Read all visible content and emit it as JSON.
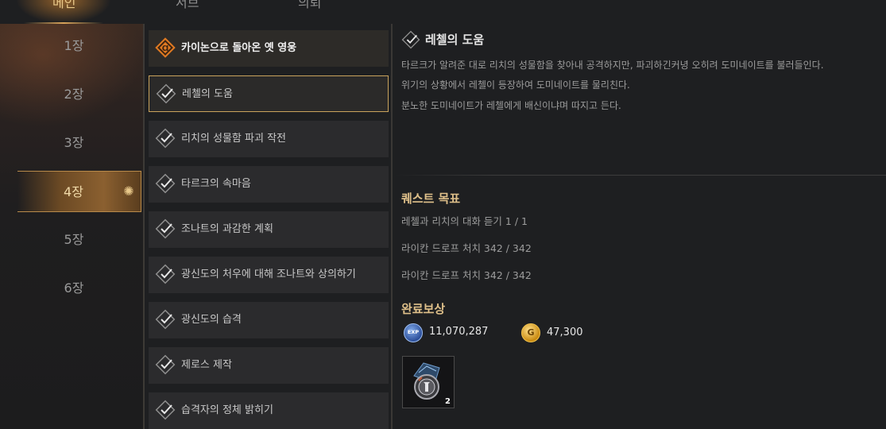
{
  "tabs": [
    {
      "label": "메인",
      "active": true
    },
    {
      "label": "서브",
      "active": false
    },
    {
      "label": "의뢰",
      "active": false
    }
  ],
  "chapters": [
    {
      "label": "1장",
      "active": false
    },
    {
      "label": "2장",
      "active": false
    },
    {
      "label": "3장",
      "active": false
    },
    {
      "label": "4장",
      "active": true
    },
    {
      "label": "5장",
      "active": false
    },
    {
      "label": "6장",
      "active": false
    }
  ],
  "quests": [
    {
      "label": "카이논으로 돌아온 옛 영웅",
      "state": "current"
    },
    {
      "label": "레첼의 도움",
      "state": "selected"
    },
    {
      "label": "리치의 성물함 파괴 작전",
      "state": "done"
    },
    {
      "label": "타르크의 속마음",
      "state": "done"
    },
    {
      "label": "조나트의 과감한 계획",
      "state": "done"
    },
    {
      "label": "광신도의 처우에 대해 조나트와 상의하기",
      "state": "done"
    },
    {
      "label": "광신도의 습격",
      "state": "done"
    },
    {
      "label": "제로스 제작",
      "state": "done"
    },
    {
      "label": "습격자의 정체 밝히기",
      "state": "done"
    }
  ],
  "detail": {
    "title": "레첼의 도움",
    "description": [
      "타르크가 알려준 대로 리치의 성물함을 찾아내 공격하지만, 파괴하긴커녕 오히려 도미네이트를 불러들인다.",
      "위기의 상황에서 레첼이 등장하여 도미네이트를 물리친다.",
      "분노한 도미네이트가 레첼에게 배신이냐며 따지고 든다."
    ],
    "objectives_title": "퀘스트 목표",
    "objectives": [
      "레첼과 리치의 대화 듣기 1 / 1",
      "라이칸 드로프 처치 342 / 342",
      "라이칸 드로프 처치 342 / 342"
    ],
    "rewards_title": "완료보상",
    "rewards": {
      "exp_icon_text": "EXP",
      "exp": "11,070,287",
      "gold_icon_text": "G",
      "gold": "47,300",
      "item_count": "2"
    }
  },
  "icons": {
    "quest_done": "checkmark-diamond-icon",
    "quest_current": "orange-quest-marker-icon",
    "exp": "exp-orb-icon",
    "gold": "gold-coin-icon",
    "item": "amulet-item-icon"
  },
  "colors": {
    "accent_gold": "#c9a25c",
    "title_gold": "#dfc08a",
    "current_quest_orange": "#e07a22",
    "background": "#1e1f21"
  }
}
